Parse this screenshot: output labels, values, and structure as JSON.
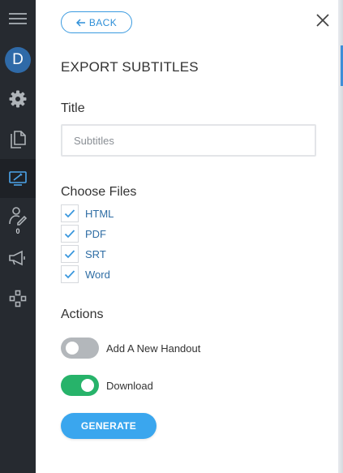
{
  "sidebar": {
    "items": [
      {
        "icon": "hamburger-menu-icon",
        "active": false
      },
      {
        "icon": "avatar",
        "avatar_letter": "D"
      },
      {
        "icon": "gear-icon",
        "active": false
      },
      {
        "icon": "documents-icon",
        "active": false
      },
      {
        "icon": "presentation-edit-icon",
        "active": true
      },
      {
        "icon": "person-edit-icon",
        "badge": "0",
        "active": false
      },
      {
        "icon": "megaphone-icon",
        "active": false
      },
      {
        "icon": "network-nodes-icon",
        "active": false
      }
    ]
  },
  "panel": {
    "back_label": "BACK",
    "title": "EXPORT SUBTITLES",
    "title_field": {
      "label": "Title",
      "value": "",
      "placeholder": "Subtitles"
    },
    "files": {
      "label": "Choose Files",
      "items": [
        {
          "label": "HTML",
          "checked": true
        },
        {
          "label": "PDF",
          "checked": true
        },
        {
          "label": "SRT",
          "checked": true
        },
        {
          "label": "Word",
          "checked": true
        }
      ]
    },
    "actions": {
      "label": "Actions",
      "toggles": [
        {
          "label": "Add A New Handout",
          "on": false
        },
        {
          "label": "Download",
          "on": true
        }
      ]
    },
    "generate_label": "GENERATE"
  },
  "colors": {
    "sidebar_bg": "#262a30",
    "accent_blue": "#3aa6ee",
    "link_blue": "#2e6da4",
    "toggle_on": "#27b36a",
    "toggle_off": "#b3b7bb",
    "avatar_bg": "#2f6aa8"
  }
}
